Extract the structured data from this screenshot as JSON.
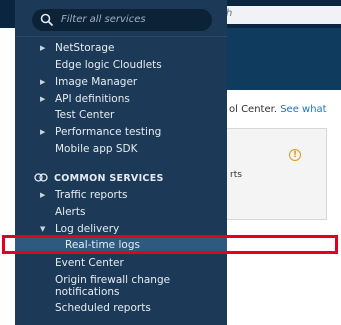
{
  "background": {
    "search_tail": "h",
    "text": "ol Center.",
    "link": "See what",
    "card_text": "rts",
    "warn_glyph": "!"
  },
  "search": {
    "placeholder": "Filter all services"
  },
  "nav": {
    "items": [
      {
        "label": "NetStorage",
        "expandable": true
      },
      {
        "label": "Edge logic Cloudlets",
        "expandable": false
      },
      {
        "label": "Image Manager",
        "expandable": true
      },
      {
        "label": "API definitions",
        "expandable": true
      },
      {
        "label": "Test Center",
        "expandable": false
      },
      {
        "label": "Performance testing",
        "expandable": true
      },
      {
        "label": "Mobile app SDK",
        "expandable": false
      }
    ],
    "section_title": "COMMON SERVICES",
    "common_items": [
      {
        "label": "Traffic reports",
        "expandable": true
      },
      {
        "label": "Alerts",
        "expandable": false
      },
      {
        "label": "Log delivery",
        "expandable": true,
        "expanded": true
      },
      {
        "label": "Real-time logs",
        "sub": true,
        "selected": true
      },
      {
        "label": "Event Center",
        "expandable": false
      },
      {
        "label": "Origin firewall change",
        "expandable": false
      },
      {
        "label": "notifications",
        "continuation": true
      },
      {
        "label": "Scheduled reports",
        "expandable": false
      }
    ]
  },
  "colors": {
    "drawer_bg": "#1c3a57",
    "highlight": "#e3001b",
    "link": "#1a73c8",
    "warning": "#d89c1a"
  }
}
